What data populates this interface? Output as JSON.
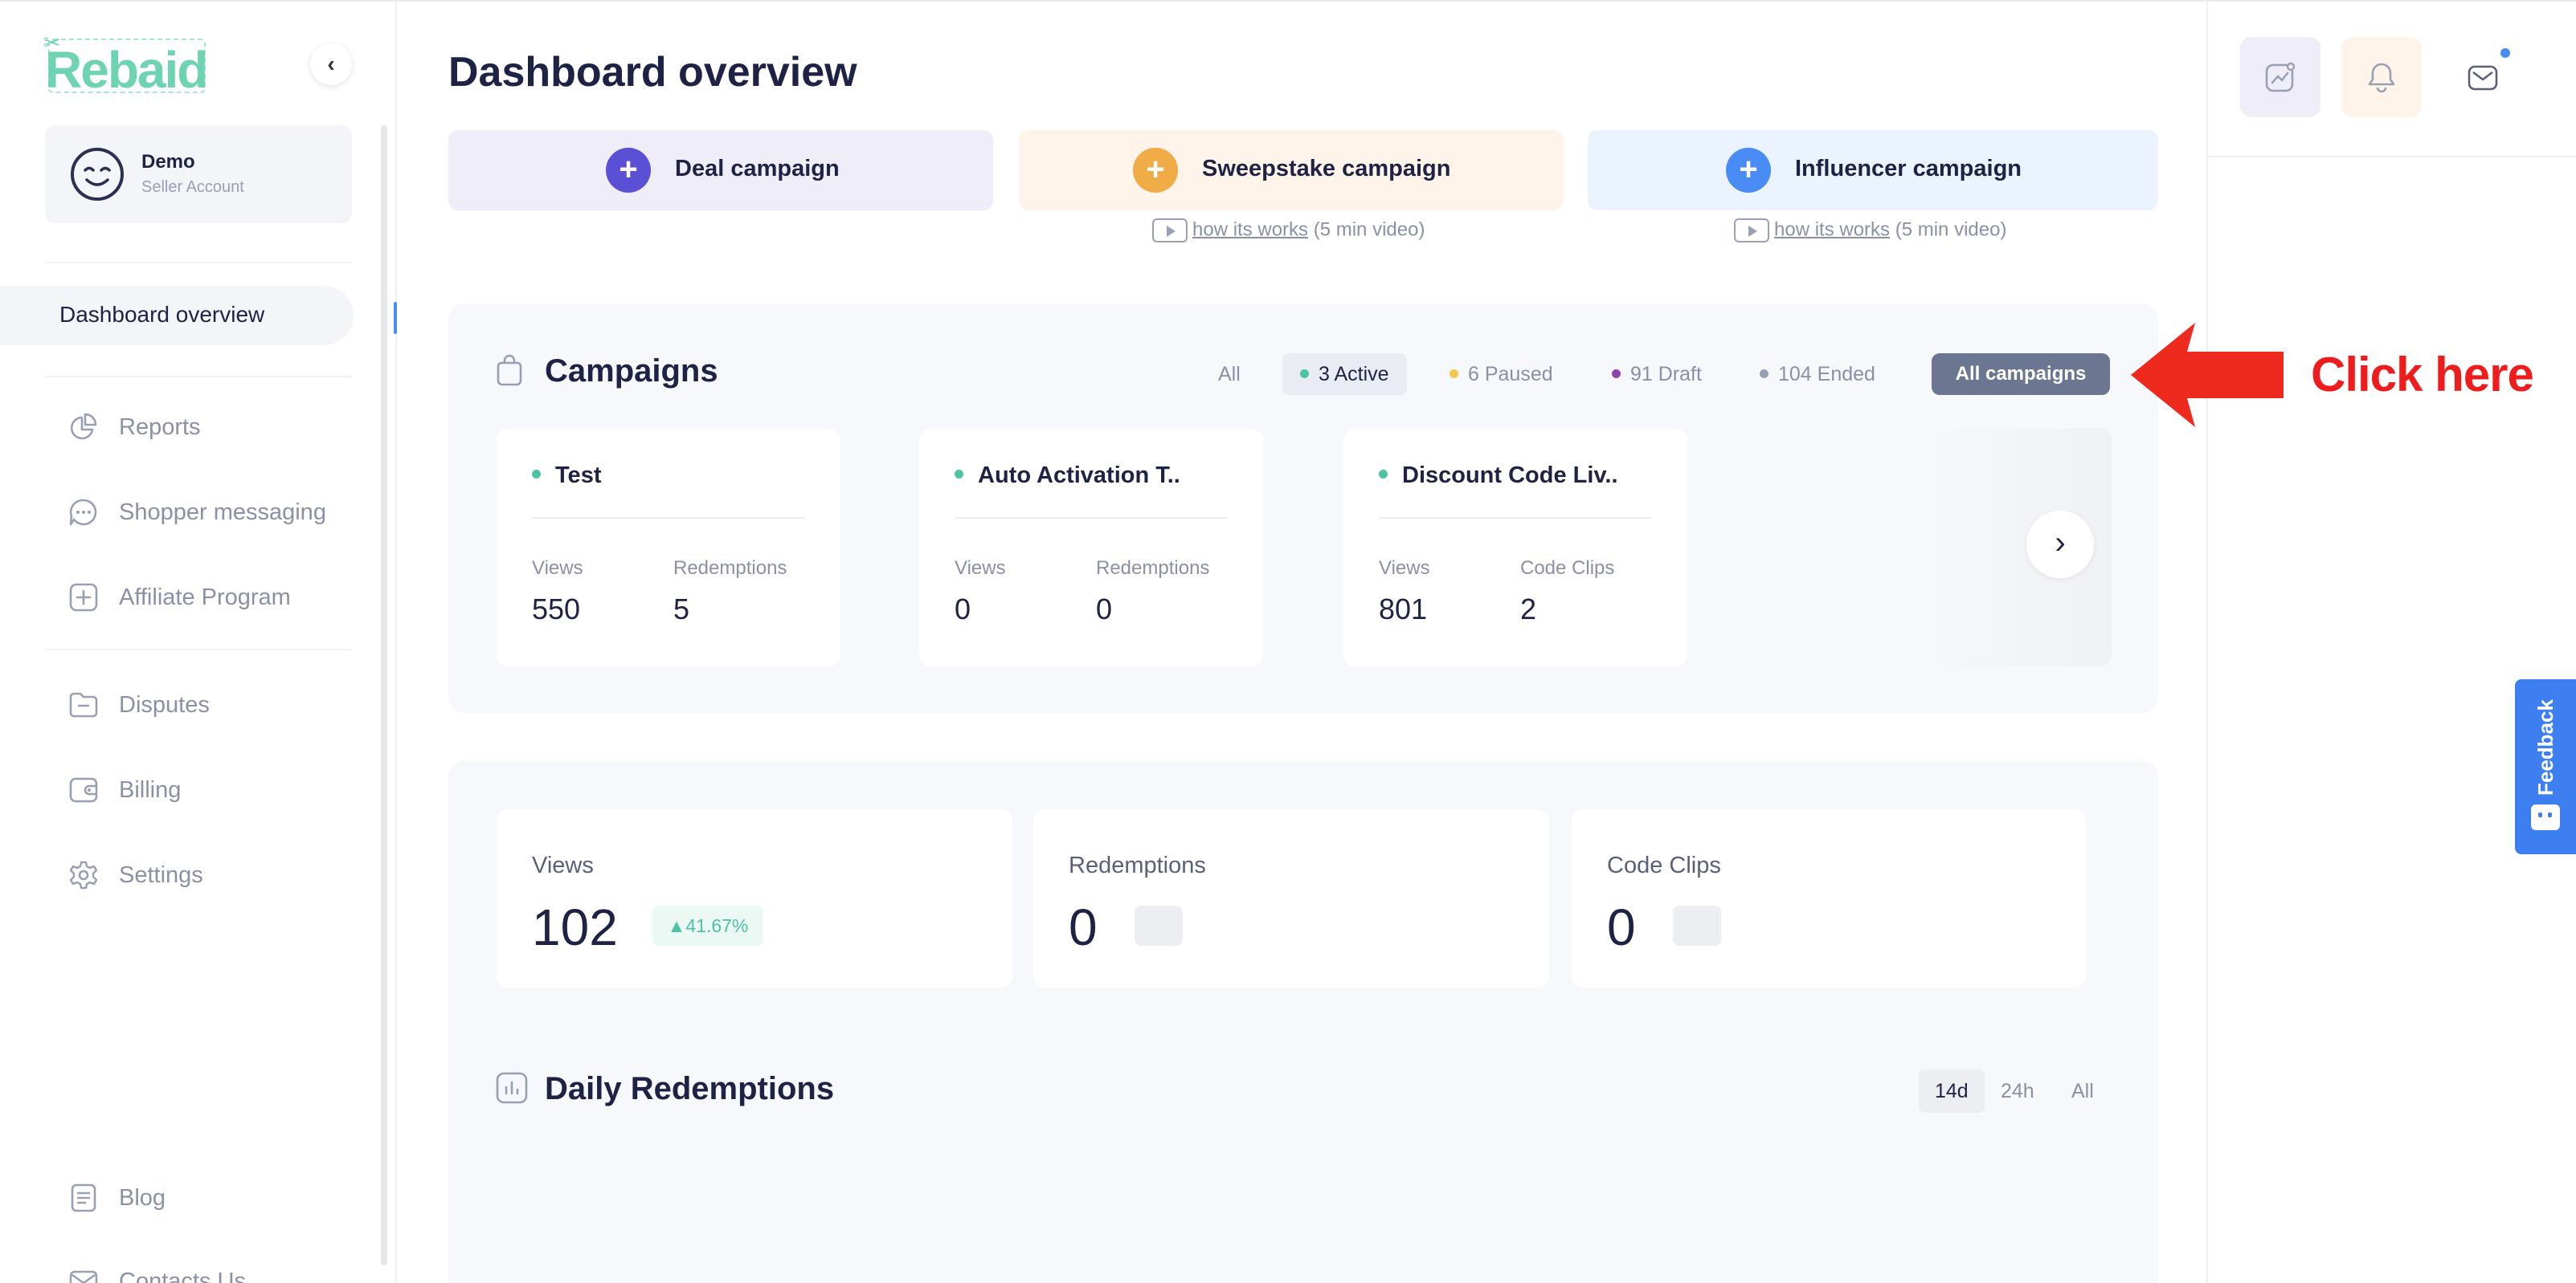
{
  "app": {
    "logo_text": "Rebaid"
  },
  "account": {
    "name": "Demo",
    "role": "Seller Account"
  },
  "sidebar": {
    "active_item": "Dashboard overview",
    "items": [
      {
        "label": "Reports",
        "icon": "pie-chart-icon"
      },
      {
        "label": "Shopper messaging",
        "icon": "chat-bubble-icon"
      },
      {
        "label": "Affiliate Program",
        "icon": "plus-square-icon"
      },
      {
        "label": "Disputes",
        "icon": "folder-minus-icon"
      },
      {
        "label": "Billing",
        "icon": "wallet-icon"
      },
      {
        "label": "Settings",
        "icon": "gear-icon"
      },
      {
        "label": "Blog",
        "icon": "document-icon"
      },
      {
        "label": "Contacts Us",
        "icon": "mail-icon"
      }
    ]
  },
  "page": {
    "title": "Dashboard overview"
  },
  "create_buttons": [
    {
      "label": "Deal campaign",
      "color": "#5b4fd6",
      "bg": "#efedf8"
    },
    {
      "label": "Sweepstake campaign",
      "color": "#f0ac47",
      "bg": "#fef4ea"
    },
    {
      "label": "Influencer campaign",
      "color": "#4a8cf5",
      "bg": "#ebf3fe"
    }
  ],
  "howto": {
    "link": "how its works",
    "duration": "(5 min video)"
  },
  "campaigns": {
    "title": "Campaigns",
    "filters": [
      {
        "label": "All",
        "dot": ""
      },
      {
        "label": "3 Active",
        "dot": "#4bc3a4"
      },
      {
        "label": "6 Paused",
        "dot": "#f2c94c"
      },
      {
        "label": "91 Draft",
        "dot": "#8e44ad"
      },
      {
        "label": "104 Ended",
        "dot": "#9aa0b4"
      }
    ],
    "all_button": "All campaigns",
    "cards": [
      {
        "name": "Test",
        "stat1_label": "Views",
        "stat1_value": "550",
        "stat2_label": "Redemptions",
        "stat2_value": "5"
      },
      {
        "name": "Auto Activation T..",
        "stat1_label": "Views",
        "stat1_value": "0",
        "stat2_label": "Redemptions",
        "stat2_value": "0"
      },
      {
        "name": "Discount Code Liv..",
        "stat1_label": "Views",
        "stat1_value": "801",
        "stat2_label": "Code Clips",
        "stat2_value": "2"
      }
    ]
  },
  "stats": [
    {
      "label": "Views",
      "value": "102",
      "change": "41.67%"
    },
    {
      "label": "Redemptions",
      "value": "0"
    },
    {
      "label": "Code Clips",
      "value": "0"
    }
  ],
  "daily": {
    "title": "Daily Redemptions",
    "ranges": [
      "14d",
      "24h",
      "All"
    ],
    "active_range": "14d"
  },
  "feedback": {
    "label": "Feedback"
  },
  "annotation": {
    "text": "Click here",
    "color": "#ee1d1d"
  }
}
